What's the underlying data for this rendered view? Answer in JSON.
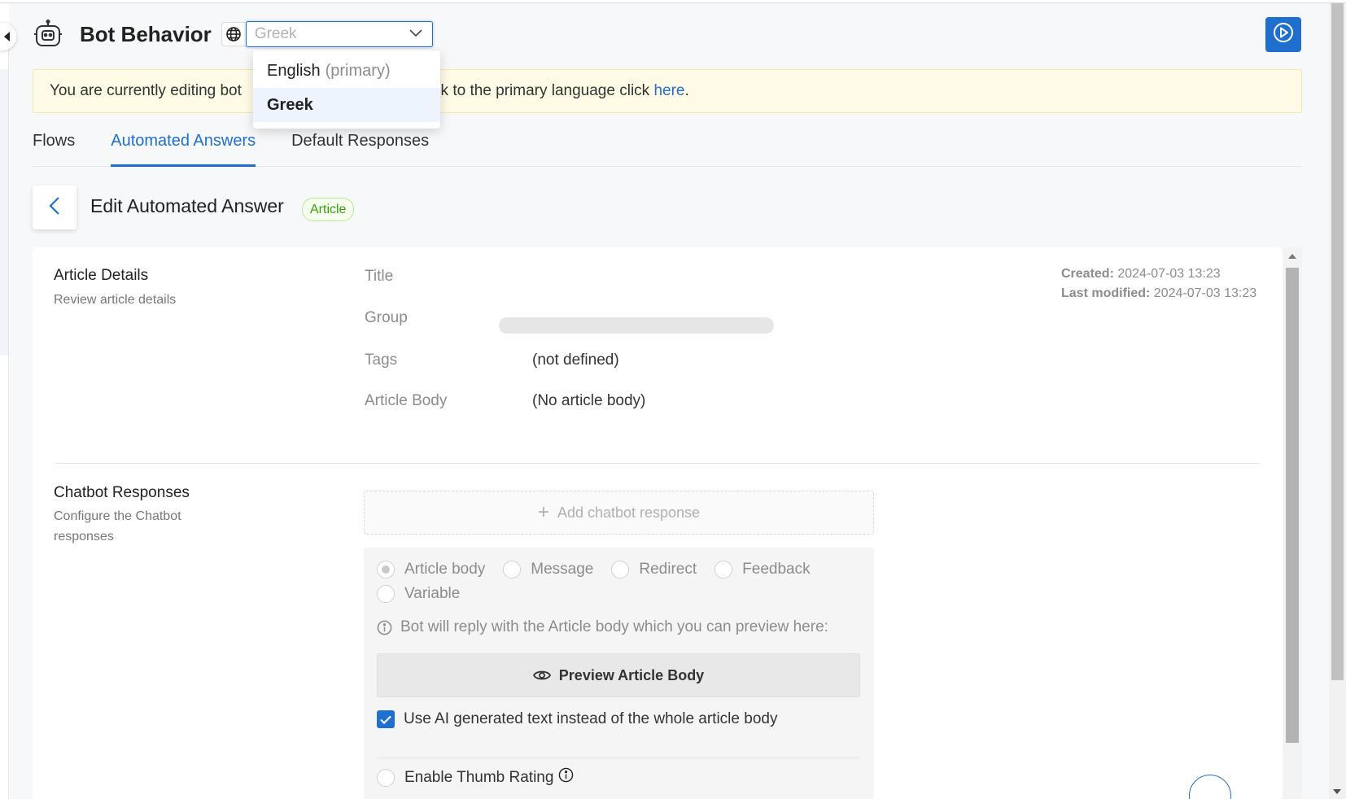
{
  "header": {
    "title": "Bot Behavior",
    "language_value": "Greek"
  },
  "language_dropdown": {
    "options": [
      {
        "label": "English",
        "suffix": "(primary)"
      },
      {
        "label": "Greek",
        "suffix": ""
      }
    ]
  },
  "banner": {
    "text_start": "You are currently editing bot",
    "text_end": "back to the primary language click",
    "link": "here",
    "trailing": "."
  },
  "tabs": [
    {
      "label": "Flows"
    },
    {
      "label": "Automated Answers"
    },
    {
      "label": "Default Responses"
    }
  ],
  "page": {
    "heading": "Edit Automated Answer",
    "type_badge": "Article"
  },
  "article_details": {
    "title": "Article Details",
    "subtitle": "Review article details",
    "fields": [
      {
        "label": "Title",
        "value": ""
      },
      {
        "label": "Group",
        "value": ""
      },
      {
        "label": "Tags",
        "value": "(not defined)"
      },
      {
        "label": "Article Body",
        "value": "(No article body)"
      }
    ],
    "created_label": "Created:",
    "created_value": "2024-07-03 13:23",
    "modified_label": "Last modified:",
    "modified_value": "2024-07-03 13:23"
  },
  "chatbot_responses": {
    "title": "Chatbot Responses",
    "subtitle_line1": "Configure the Chatbot",
    "subtitle_line2": "responses",
    "add_button": "Add chatbot response",
    "response_types": [
      "Article body",
      "Message",
      "Redirect",
      "Feedback",
      "Variable"
    ],
    "selected_type": "Article body",
    "info_text": "Bot will reply with the Article body which you can preview here:",
    "preview_button": "Preview Article Body",
    "ai_checkbox_label": "Use AI generated text instead of the whole article body",
    "ai_checkbox_checked": true,
    "thumb_rating_label": "Enable Thumb Rating"
  },
  "colors": {
    "accent": "#1f6fce",
    "banner_bg": "#fffbe6",
    "badge_green": "#389e0d"
  }
}
